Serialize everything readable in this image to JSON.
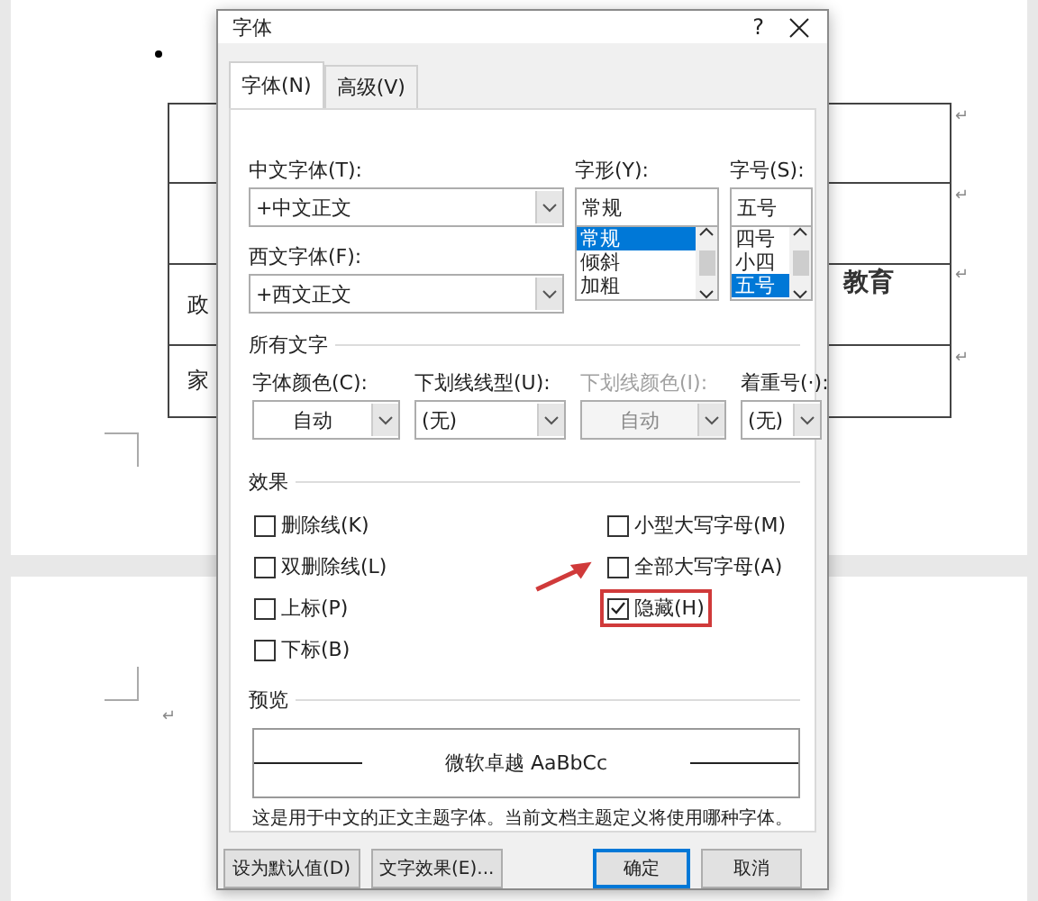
{
  "document": {
    "table_cells": [
      "政",
      "家"
    ],
    "logo_text": "教育",
    "paragraph_marks": [
      "↵",
      "↵",
      "↵",
      "↵",
      "↵"
    ]
  },
  "dialog": {
    "title": "字体",
    "help": "?",
    "tabs": [
      {
        "label": "字体(N)",
        "selected": true
      },
      {
        "label": "高级(V)",
        "selected": false
      }
    ],
    "chinese_font": {
      "label": "中文字体(T):",
      "value": "+中文正文"
    },
    "western_font": {
      "label": "西文字体(F):",
      "value": "+西文正文"
    },
    "font_style": {
      "label": "字形(Y):",
      "value": "常规",
      "options": [
        {
          "label": "常规",
          "selected": true
        },
        {
          "label": "倾斜",
          "selected": false
        },
        {
          "label": "加粗",
          "selected": false
        }
      ]
    },
    "font_size": {
      "label": "字号(S):",
      "value": "五号",
      "options": [
        {
          "label": "四号",
          "selected": false
        },
        {
          "label": "小四",
          "selected": false
        },
        {
          "label": "五号",
          "selected": true
        }
      ]
    },
    "all_text": {
      "heading": "所有文字",
      "fields": [
        {
          "label": "字体颜色(C):",
          "value": "自动",
          "kind": "color",
          "disabled": false
        },
        {
          "label": "下划线线型(U):",
          "value": "(无)",
          "kind": "list",
          "disabled": false
        },
        {
          "label": "下划线颜色(I):",
          "value": "自动",
          "kind": "color",
          "disabled": true
        },
        {
          "label": "着重号(·):",
          "value": "(无)",
          "kind": "list",
          "disabled": false
        }
      ]
    },
    "effects": {
      "heading": "效果",
      "left": [
        {
          "label": "删除线(K)",
          "checked": false,
          "highlighted": false
        },
        {
          "label": "双删除线(L)",
          "checked": false,
          "highlighted": false
        },
        {
          "label": "上标(P)",
          "checked": false,
          "highlighted": false
        },
        {
          "label": "下标(B)",
          "checked": false,
          "highlighted": false
        }
      ],
      "right": [
        {
          "label": "小型大写字母(M)",
          "checked": false,
          "highlighted": false
        },
        {
          "label": "全部大写字母(A)",
          "checked": false,
          "highlighted": false
        },
        {
          "label": "隐藏(H)",
          "checked": true,
          "highlighted": true
        }
      ]
    },
    "preview": {
      "heading": "预览",
      "sample": "微软卓越  AaBbCc",
      "note": "这是用于中文的正文主题字体。当前文档主题定义将使用哪种字体。"
    },
    "buttons": [
      {
        "label": "设为默认值(D)",
        "primary": false
      },
      {
        "label": "文字效果(E)...",
        "primary": false
      },
      {
        "label": "确定",
        "primary": true
      },
      {
        "label": "取消",
        "primary": false
      }
    ]
  }
}
